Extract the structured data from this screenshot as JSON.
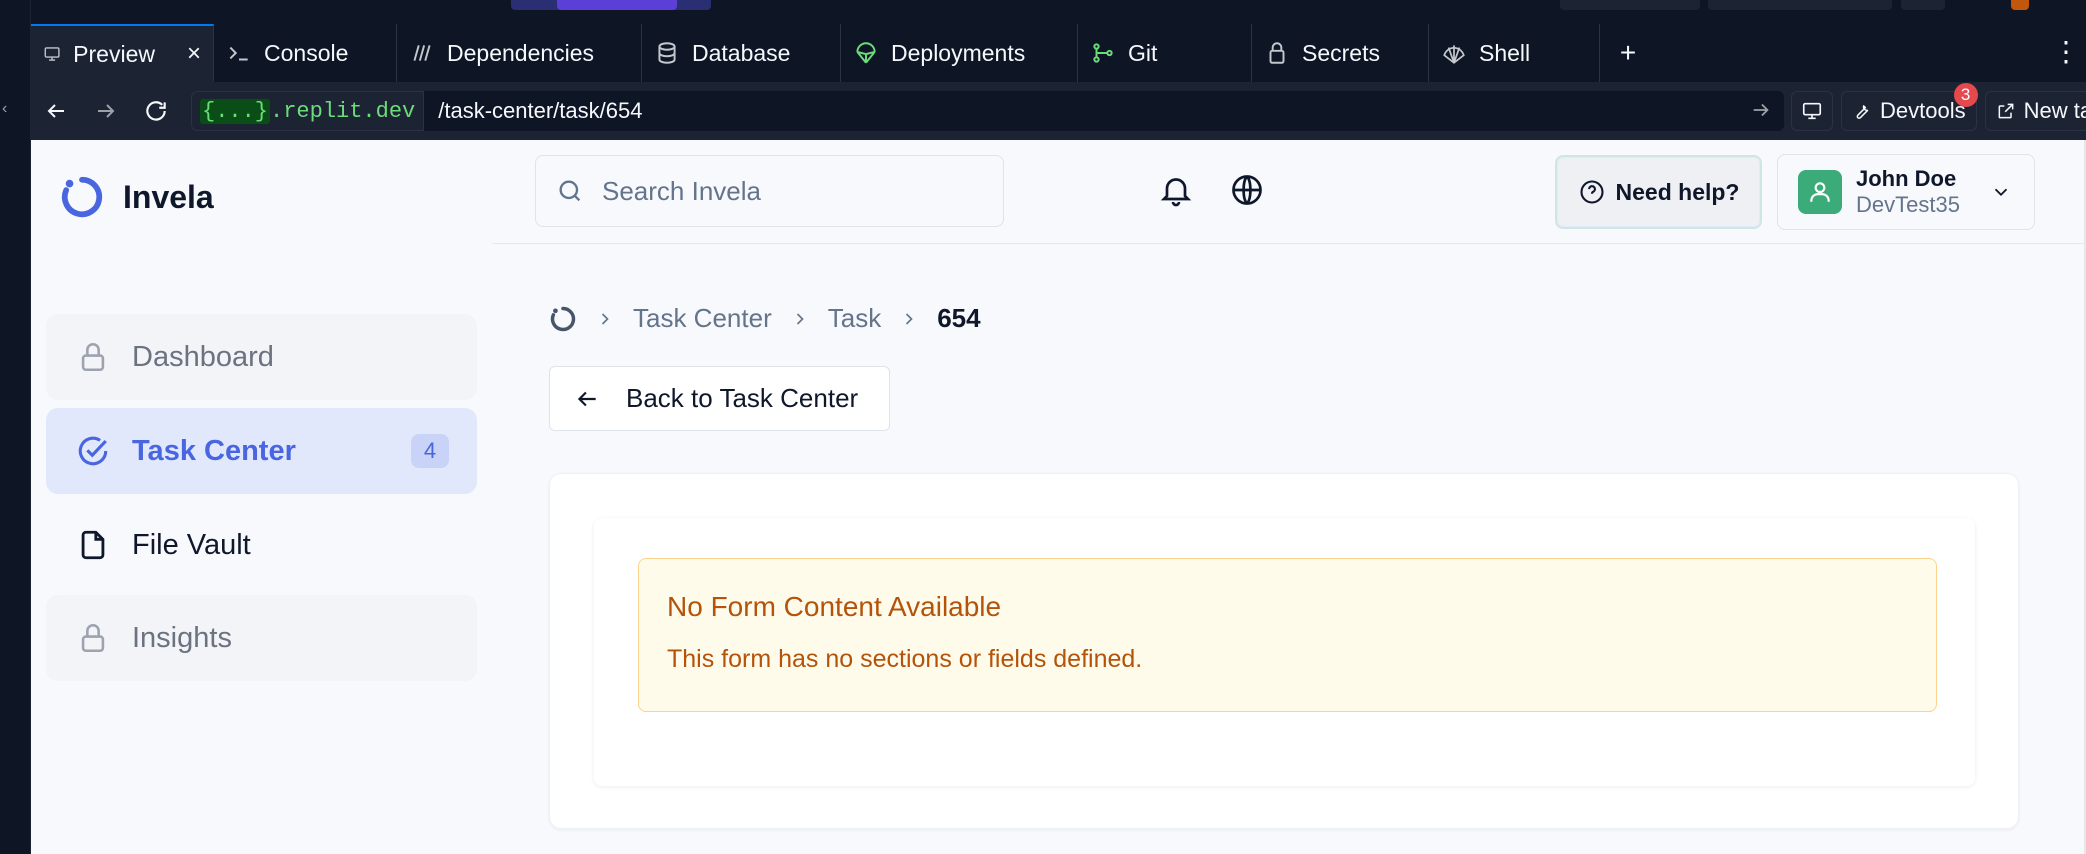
{
  "replit": {
    "tabs": [
      {
        "label": "Preview",
        "icon": "monitor-icon"
      },
      {
        "label": "Console",
        "icon": "terminal-icon"
      },
      {
        "label": "Dependencies",
        "icon": "dependencies-icon"
      },
      {
        "label": "Database",
        "icon": "database-icon"
      },
      {
        "label": "Deployments",
        "icon": "deployments-icon"
      },
      {
        "label": "Git",
        "icon": "git-icon"
      },
      {
        "label": "Secrets",
        "icon": "lock-icon"
      },
      {
        "label": "Shell",
        "icon": "shell-icon"
      }
    ],
    "add_tab": "+",
    "url": {
      "domain_braces": "{...}",
      "domain_rest": ".replit.dev",
      "path": "/task-center/task/654"
    },
    "devtools_label": "Devtools",
    "devtools_badge": "3",
    "new_tab_label": "New tab"
  },
  "app": {
    "brand": "Invela",
    "nav": [
      {
        "label": "Dashboard",
        "state": "locked"
      },
      {
        "label": "Task Center",
        "state": "active",
        "count": "4"
      },
      {
        "label": "File Vault",
        "state": "normal"
      },
      {
        "label": "Insights",
        "state": "locked"
      }
    ],
    "search": {
      "placeholder": "Search Invela",
      "value": ""
    },
    "help_label": "Need help?",
    "user": {
      "name": "John Doe",
      "org": "DevTest35"
    },
    "breadcrumb": {
      "items": [
        "Task Center",
        "Task"
      ],
      "current": "654"
    },
    "back_label": "Back to Task Center",
    "notice": {
      "title": "No Form Content Available",
      "body": "This form has no sections or fields defined."
    },
    "colors": {
      "accent": "#4965e0",
      "warning_text": "#b45309",
      "warning_bg": "#fefbeb",
      "avatar": "#3cab7a"
    }
  }
}
